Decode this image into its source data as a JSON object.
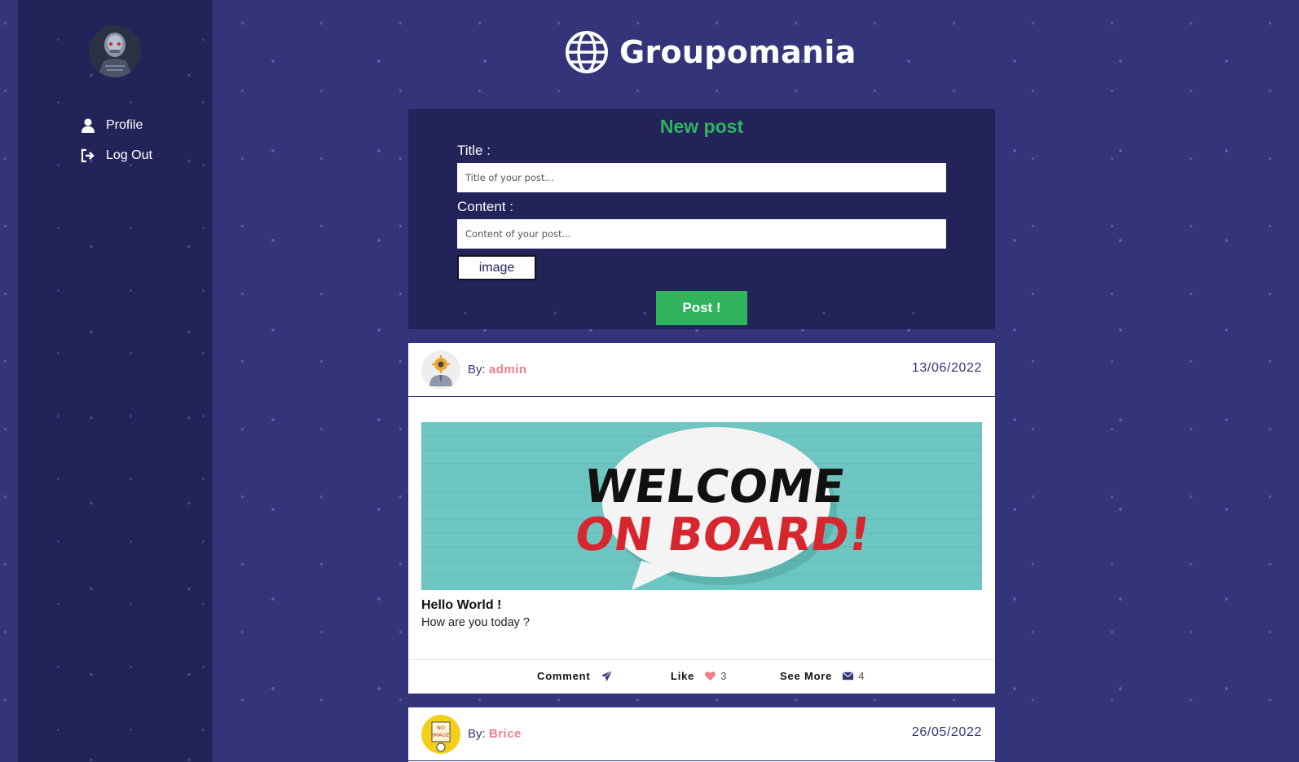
{
  "sidebar": {
    "items": [
      {
        "label": "Profile",
        "icon": "user-icon"
      },
      {
        "label": "Log Out",
        "icon": "logout-icon"
      }
    ]
  },
  "header": {
    "title": "Groupomania",
    "icon": "globe-icon"
  },
  "new_post": {
    "heading": "New post",
    "title_label": "Title :",
    "title_placeholder": "Title of your post...",
    "content_label": "Content :",
    "content_placeholder": "Content of your post...",
    "image_button": "image",
    "submit_button": "Post !"
  },
  "posts": [
    {
      "by_label": "By:",
      "author": "admin",
      "date": "13/06/2022",
      "title": "Hello World !",
      "content": "How are you today ?",
      "image_text_line1": "WELCOME",
      "image_text_line2": "ON BOARD!",
      "actions": {
        "comment_label": "Comment",
        "like_label": "Like",
        "like_count": "3",
        "see_more_label": "See More",
        "see_more_count": "4"
      }
    },
    {
      "by_label": "By:",
      "author": "Brice",
      "date": "26/05/2022",
      "avatar_text_line1": "NO",
      "avatar_text_line2": "IMAGE"
    }
  ],
  "colors": {
    "page_bg": "#34347a",
    "panel_bg": "#23235a",
    "accent_green": "#2fb35c",
    "author_pink": "#f27d8a"
  }
}
